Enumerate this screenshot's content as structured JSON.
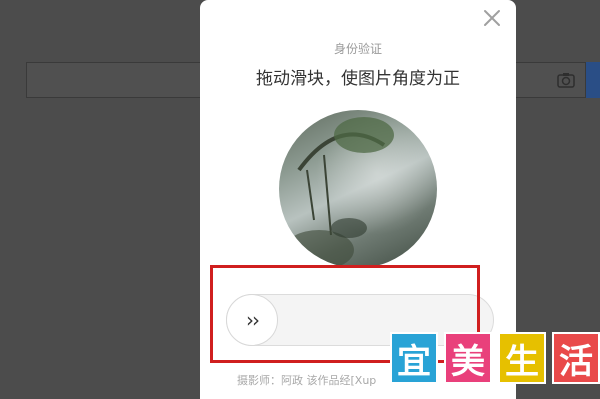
{
  "background": {
    "camera_icon": "camera-icon"
  },
  "modal": {
    "subtitle": "身份验证",
    "title": "拖动滑块，使图片角度为正",
    "close_icon": "close-icon",
    "slider": {
      "handle_glyph": "››",
      "value": 0
    },
    "credit": "摄影师：阿政 该作品经[Xup"
  },
  "watermark": {
    "chars": [
      "宜",
      "美",
      "生",
      "活"
    ]
  },
  "colors": {
    "overlay": "#4c4c4c",
    "highlight_box": "#d01f1f",
    "tile_blue": "#29a3d6",
    "tile_pink": "#e9407b",
    "tile_yellow": "#e6c000",
    "tile_red": "#e94a4a"
  }
}
